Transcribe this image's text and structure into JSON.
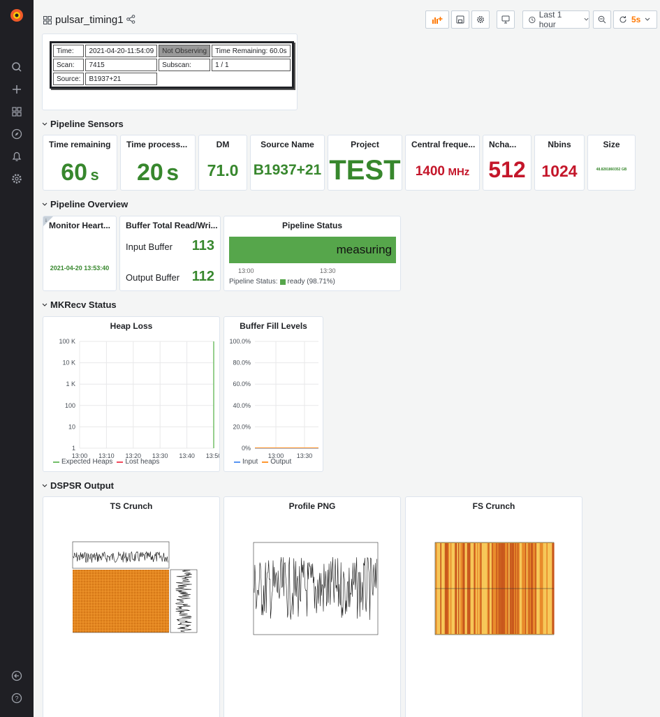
{
  "dashboard": {
    "title": "pulsar_timing1"
  },
  "toolbar": {
    "time_range": "Last 1 hour",
    "refresh_interval": "5s"
  },
  "info_table": {
    "time_label": "Time:",
    "time_value": "2021-04-20-11:54:09",
    "status": "Not Observing",
    "time_remaining": "Time Remaining: 60.0s",
    "scan_label": "Scan:",
    "scan_value": "7415",
    "subscan_label": "Subscan:",
    "subscan_value": "1 / 1",
    "source_label": "Source:",
    "source_value": "B1937+21"
  },
  "rows": {
    "sensors": "Pipeline Sensors",
    "overview": "Pipeline Overview",
    "mkrecv": "MKRecv Status",
    "dspsr": "DSPSR Output"
  },
  "sensors": [
    {
      "title": "Time remaining",
      "value": "60",
      "unit": "s"
    },
    {
      "title": "Time process...",
      "value": "20",
      "unit": "s"
    },
    {
      "title": "DM",
      "value": "71.0"
    },
    {
      "title": "Source Name",
      "value": "B1937+21"
    },
    {
      "title": "Project",
      "value": "TEST"
    },
    {
      "title": "Central freque...",
      "value": "1400",
      "unit": "MHz"
    },
    {
      "title": "Ncha...",
      "value": "512"
    },
    {
      "title": "Nbins",
      "value": "1024"
    },
    {
      "title": "Size",
      "value": "48.8281860352 GB"
    }
  ],
  "overview": {
    "heartbeat_title": "Monitor Heart...",
    "heartbeat_value": "2021-04-20 13:53:40",
    "buffer_title": "Buffer Total Read/Wri...",
    "input_label": "Input Buffer",
    "input_value": "113",
    "output_label": "Output Buffer",
    "output_value": "112",
    "status_title": "Pipeline Status",
    "status_value": "measuring",
    "status_ticks": [
      "13:00",
      "13:30"
    ],
    "status_legend": "Pipeline Status:",
    "status_legend_value": "ready (98.71%)"
  },
  "mkrecv": {
    "heap_title": "Heap Loss",
    "fill_title": "Buffer Fill Levels"
  },
  "chart_data": [
    {
      "type": "line",
      "title": "Heap Loss",
      "x": [
        "13:00",
        "13:10",
        "13:20",
        "13:30",
        "13:40",
        "13:50"
      ],
      "ylabels": [
        "100 K",
        "10 K",
        "1 K",
        "100",
        "10",
        "1"
      ],
      "yscale": "log",
      "series": [
        {
          "name": "Expected Heaps",
          "color": "#73bf69"
        },
        {
          "name": "Lost heaps",
          "color": "#f2495c"
        }
      ],
      "legend": "bottom"
    },
    {
      "type": "line",
      "title": "Buffer Fill Levels",
      "x": [
        "13:00",
        "13:30"
      ],
      "ylabels": [
        "100.0%",
        "80.0%",
        "60.0%",
        "40.0%",
        "20.0%",
        "0%"
      ],
      "ylim": [
        0,
        100
      ],
      "series": [
        {
          "name": "Input",
          "color": "#5794f2",
          "values": [
            0,
            0
          ]
        },
        {
          "name": "Output",
          "color": "#ff9830",
          "values": [
            0,
            0
          ]
        }
      ],
      "legend": "bottom"
    }
  ],
  "dspsr": {
    "ts_title": "TS Crunch",
    "profile_title": "Profile PNG",
    "fs_title": "FS Crunch"
  },
  "colors": {
    "green": "#37872d",
    "red": "#c4162a",
    "accent": "#ff7800"
  }
}
